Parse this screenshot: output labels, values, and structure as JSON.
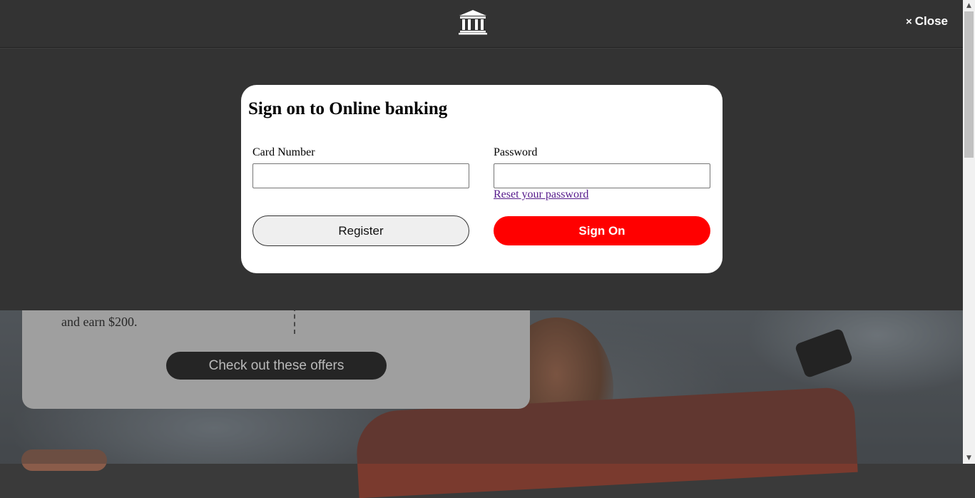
{
  "header": {
    "logo_icon": "bank-building-icon",
    "close_label": "Close",
    "close_icon": "×"
  },
  "modal": {
    "title": "Sign on to Online banking",
    "card_number_label": "Card Number",
    "card_number_value": "",
    "password_label": "Password",
    "password_value": "",
    "reset_link": "Reset your password",
    "register_label": "Register",
    "signon_label": "Sign On"
  },
  "background": {
    "offer_text": "and earn $200.",
    "offer_button": "Check out these offers"
  },
  "colors": {
    "overlay": "#333333",
    "signon": "#ff0000",
    "link": "#551a8b"
  },
  "scrollbar": {
    "up_icon": "▲",
    "down_icon": "▼"
  }
}
